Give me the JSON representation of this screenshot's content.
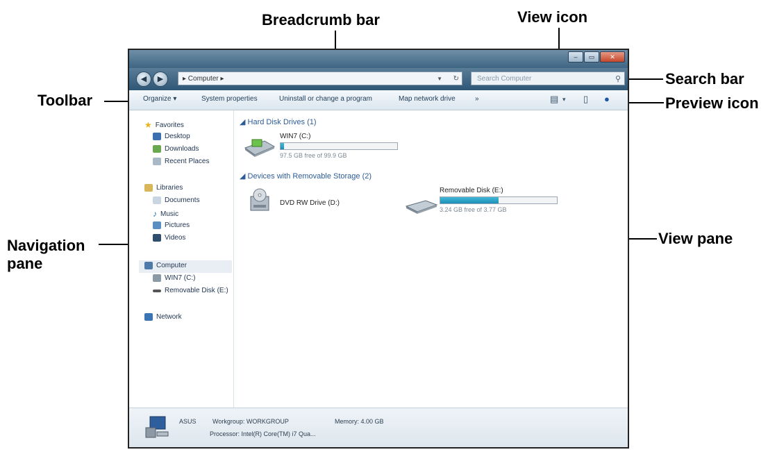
{
  "annotations": {
    "breadcrumb_bar": "Breadcrumb bar",
    "view_icon": "View icon",
    "search_bar": "Search bar",
    "toolbar": "Toolbar",
    "preview_icon": "Preview icon",
    "navigation_pane": "Navigation pane",
    "view_pane": "View pane"
  },
  "window": {
    "breadcrumb": "▸ Computer ▸",
    "search_placeholder": "Search Computer",
    "toolbar": {
      "organize": "Organize ▾",
      "system_properties": "System properties",
      "uninstall": "Uninstall or change a program",
      "map_drive": "Map network drive",
      "more": "»"
    },
    "nav": {
      "favorites": "Favorites",
      "desktop": "Desktop",
      "downloads": "Downloads",
      "recent": "Recent Places",
      "libraries": "Libraries",
      "documents": "Documents",
      "music": "Music",
      "pictures": "Pictures",
      "videos": "Videos",
      "computer": "Computer",
      "c_drive": "WIN7 (C:)",
      "removable": "Removable Disk (E:)",
      "network": "Network"
    },
    "view": {
      "hdd_header": "Hard Disk Drives (1)",
      "c_name": "WIN7 (C:)",
      "c_space": "97.5 GB free of 99.9 GB",
      "c_usage": 0.03,
      "removable_header": "Devices with Removable Storage (2)",
      "dvd_name": "DVD RW Drive (D:)",
      "usb_name": "Removable Disk (E:)",
      "usb_space": "3.24 GB free of 3.77 GB",
      "usb_usage": 0.5
    },
    "status": {
      "pc_name": "ASUS",
      "workgroup": "Workgroup: WORKGROUP",
      "memory": "Memory: 4.00 GB",
      "processor": "Processor: Intel(R) Core(TM) i7 Qua..."
    }
  },
  "colors": {
    "accent": "#2d5c99",
    "bar_fill": "#1b8fb8"
  }
}
